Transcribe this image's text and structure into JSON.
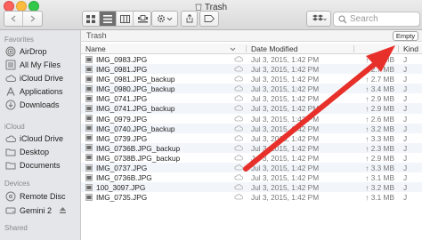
{
  "window": {
    "title": "Trash"
  },
  "toolbar": {
    "search_placeholder": "Search"
  },
  "sidebar": {
    "favorites_heading": "Favorites",
    "favorites": [
      {
        "label": "AirDrop",
        "icon": "airdrop-icon"
      },
      {
        "label": "All My Files",
        "icon": "all-files-icon"
      },
      {
        "label": "iCloud Drive",
        "icon": "cloud-icon"
      },
      {
        "label": "Applications",
        "icon": "applications-icon"
      },
      {
        "label": "Downloads",
        "icon": "downloads-icon"
      }
    ],
    "icloud_heading": "iCloud",
    "icloud": [
      {
        "label": "iCloud Drive",
        "icon": "cloud-icon"
      },
      {
        "label": "Desktop",
        "icon": "folder-icon"
      },
      {
        "label": "Documents",
        "icon": "folder-icon"
      }
    ],
    "devices_heading": "Devices",
    "devices": [
      {
        "label": "Remote Disc",
        "icon": "disc-icon"
      },
      {
        "label": "Gemini 2",
        "icon": "drive-icon"
      }
    ],
    "shared_heading": "Shared"
  },
  "main": {
    "path": "Trash",
    "empty_button": "Empty",
    "columns": {
      "name": "Name",
      "date": "Date Modified",
      "kind": "Kind"
    },
    "rows": [
      {
        "name": "IMG_0983.JPG",
        "date": "Jul 3, 2015, 1:42 PM",
        "size": "3.3 MB"
      },
      {
        "name": "IMG_0981.JPG",
        "date": "Jul 3, 2015, 1:42 PM",
        "size": "2.7 MB"
      },
      {
        "name": "IMG_0981.JPG_backup",
        "date": "Jul 3, 2015, 1:42 PM",
        "size": "2.7 MB"
      },
      {
        "name": "IMG_0980.JPG_backup",
        "date": "Jul 3, 2015, 1:42 PM",
        "size": "3.4 MB"
      },
      {
        "name": "IMG_0741.JPG",
        "date": "Jul 3, 2015, 1:42 PM",
        "size": "2.9 MB"
      },
      {
        "name": "IMG_0741.JPG_backup",
        "date": "Jul 3, 2015, 1:42 PM",
        "size": "2.9 MB"
      },
      {
        "name": "IMG_0979.JPG",
        "date": "Jul 3, 2015, 1:42 PM",
        "size": "2.6 MB"
      },
      {
        "name": "IMG_0740.JPG_backup",
        "date": "Jul 3, 2015, 1:42 PM",
        "size": "3.2 MB"
      },
      {
        "name": "IMG_0739.JPG",
        "date": "Jul 3, 2015, 1:42 PM",
        "size": "3.3 MB"
      },
      {
        "name": "IMG_0736B.JPG_backup",
        "date": "Jul 3, 2015, 1:42 PM",
        "size": "2.3 MB"
      },
      {
        "name": "IMG_0738B.JPG_backup",
        "date": "Jul 3, 2015, 1:42 PM",
        "size": "2.9 MB"
      },
      {
        "name": "IMG_0737.JPG",
        "date": "Jul 3, 2015, 1:42 PM",
        "size": "3.3 MB"
      },
      {
        "name": "IMG_0736B.JPG",
        "date": "Jul 3, 2015, 1:42 PM",
        "size": "3.1 MB"
      },
      {
        "name": "100_3097.JPG",
        "date": "Jul 3, 2015, 1:42 PM",
        "size": "3.2 MB"
      },
      {
        "name": "IMG_0735.JPG",
        "date": "Jul 3, 2015, 1:42 PM",
        "size": "3.1 MB"
      }
    ]
  },
  "annotation": {
    "arrow_color": "#e8302b"
  },
  "colors": {
    "sidebar_bg": "#e4e6e9",
    "row_alt": "#f2f5fa"
  }
}
